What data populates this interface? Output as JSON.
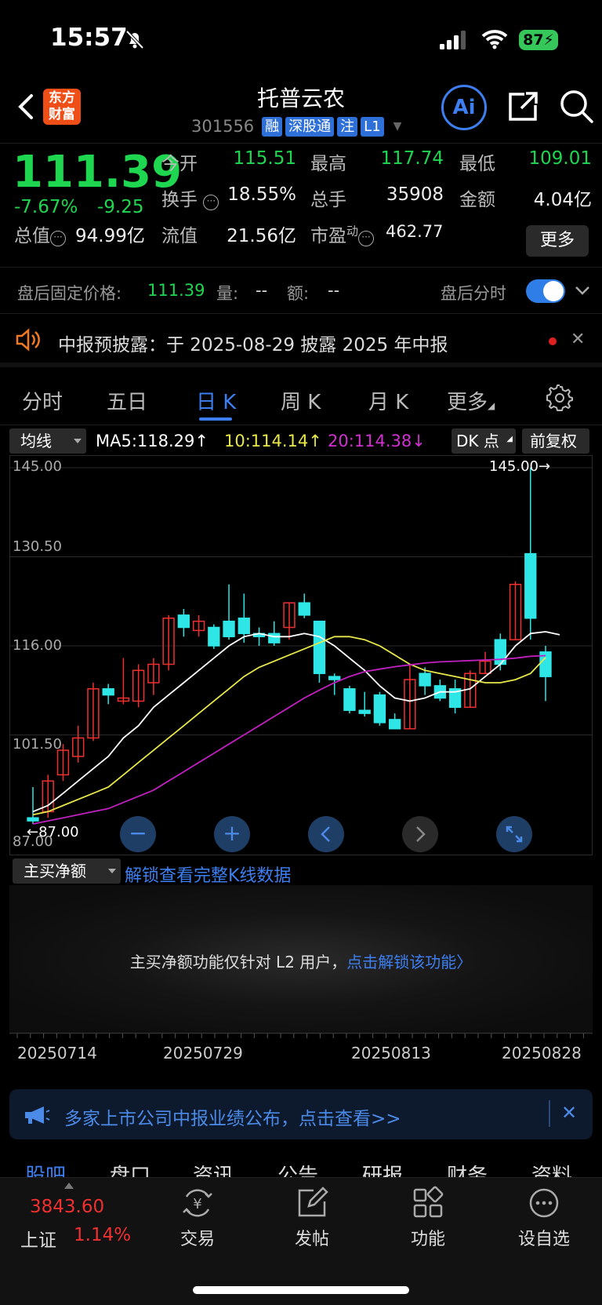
{
  "status_bar": {
    "time": "15:57",
    "battery": "87"
  },
  "header": {
    "logo_text": "东方财富",
    "title": "托普云农",
    "code": "301556",
    "tags": [
      "融",
      "深股通",
      "注",
      "L1"
    ],
    "ai_label": "Ai"
  },
  "quote": {
    "price": "111.39",
    "change_pct": "-7.67%",
    "change": "-9.25",
    "open_label": "今开",
    "open": "115.51",
    "high_label": "最高",
    "high": "117.74",
    "low_label": "最低",
    "low": "109.01",
    "turnover_label": "换手",
    "turnover": "18.55%",
    "volume_label": "总手",
    "volume": "35908",
    "amount_label": "金额",
    "amount": "4.04亿",
    "mcap_label": "总值",
    "mcap": "94.99亿",
    "float_label": "流值",
    "float": "21.56亿",
    "pe_label": "市盈",
    "pe_sup": "动",
    "pe": "462.77",
    "more_button": "更多"
  },
  "after_hours": {
    "price_label": "盘后固定价格:",
    "price": "111.39",
    "vol_label": "量:",
    "vol": "--",
    "amt_label": "额:",
    "amt": "--",
    "toggle_label": "盘后分时"
  },
  "notice": {
    "text": "中报预披露：于 2025-08-29 披露 2025 年中报"
  },
  "tabs": [
    {
      "label": "分时"
    },
    {
      "label": "五日"
    },
    {
      "label": "日 K"
    },
    {
      "label": "周 K"
    },
    {
      "label": "月 K"
    },
    {
      "label": "更多"
    }
  ],
  "ma_bar": {
    "indicator": "均线",
    "ma5": "MA5:118.29↑",
    "ma10": "10:114.14↑",
    "ma20": "20:114.38↓",
    "dk_button": "DK 点",
    "adjust_button": "前复权"
  },
  "chart_data": {
    "type": "candlestick",
    "y_labels": [
      "145.00",
      "130.50",
      "116.00",
      "101.50"
    ],
    "ylim": [
      87.0,
      145.0
    ],
    "max_annotation": "145.00→",
    "min_annotation": "←87.00",
    "min_axis_label": "87.00",
    "candles": [
      {
        "o": 88,
        "h": 93,
        "l": 87,
        "c": 87.5
      },
      {
        "o": 89,
        "h": 95,
        "l": 88,
        "c": 94
      },
      {
        "o": 95,
        "h": 100,
        "l": 94,
        "c": 99
      },
      {
        "o": 98,
        "h": 103,
        "l": 97,
        "c": 101
      },
      {
        "o": 101,
        "h": 110,
        "l": 100.5,
        "c": 109
      },
      {
        "o": 109,
        "h": 109.8,
        "l": 106.5,
        "c": 108
      },
      {
        "o": 107,
        "h": 114,
        "l": 106.5,
        "c": 107.5
      },
      {
        "o": 107,
        "h": 113,
        "l": 106,
        "c": 112
      },
      {
        "o": 110,
        "h": 114,
        "l": 108,
        "c": 113
      },
      {
        "o": 113,
        "h": 121,
        "l": 112,
        "c": 120.5
      },
      {
        "o": 121,
        "h": 122,
        "l": 117.5,
        "c": 119
      },
      {
        "o": 118.5,
        "h": 121,
        "l": 117.5,
        "c": 120
      },
      {
        "o": 119,
        "h": 119.5,
        "l": 115.5,
        "c": 116
      },
      {
        "o": 120,
        "h": 126,
        "l": 117,
        "c": 117.5
      },
      {
        "o": 120.5,
        "h": 124.5,
        "l": 116.5,
        "c": 118
      },
      {
        "o": 118,
        "h": 119,
        "l": 116,
        "c": 117.5
      },
      {
        "o": 118,
        "h": 120,
        "l": 116,
        "c": 116.5
      },
      {
        "o": 119,
        "h": 123,
        "l": 117,
        "c": 123
      },
      {
        "o": 123,
        "h": 124.5,
        "l": 120.5,
        "c": 121
      },
      {
        "o": 120,
        "h": 120,
        "l": 110,
        "c": 111.5
      },
      {
        "o": 111,
        "h": 111.5,
        "l": 108,
        "c": 110.5
      },
      {
        "o": 109,
        "h": 109.5,
        "l": 105,
        "c": 105.5
      },
      {
        "o": 105.5,
        "h": 108.5,
        "l": 104.5,
        "c": 105
      },
      {
        "o": 108,
        "h": 108.5,
        "l": 103,
        "c": 103.5
      },
      {
        "o": 104,
        "h": 105,
        "l": 102.5,
        "c": 102.5
      },
      {
        "o": 102.5,
        "h": 113,
        "l": 102.5,
        "c": 110.5
      },
      {
        "o": 111.5,
        "h": 112.5,
        "l": 108,
        "c": 109.5
      },
      {
        "o": 109.5,
        "h": 110.5,
        "l": 107,
        "c": 107.5
      },
      {
        "o": 109,
        "h": 110.5,
        "l": 105,
        "c": 106
      },
      {
        "o": 106,
        "h": 112,
        "l": 106,
        "c": 111.5
      },
      {
        "o": 111.5,
        "h": 115,
        "l": 111.5,
        "c": 113.5
      },
      {
        "o": 117,
        "h": 118,
        "l": 112,
        "c": 113
      },
      {
        "o": 117,
        "h": 126.5,
        "l": 117,
        "c": 126
      },
      {
        "o": 131,
        "h": 145,
        "l": 117,
        "c": 120.5
      },
      {
        "o": 115,
        "h": 116,
        "l": 107,
        "c": 111
      }
    ],
    "ma_series": [
      {
        "name": "MA5",
        "color": "#ffffff",
        "values": [
          89,
          90,
          92,
          94,
          96,
          98,
          101,
          103,
          106,
          108,
          110,
          112,
          114,
          116,
          117.5,
          118,
          117.5,
          117.5,
          118,
          117.5,
          116,
          114,
          112,
          109.5,
          107.5,
          107,
          107.5,
          108.5,
          108.5,
          109,
          111,
          113,
          116,
          118,
          118.3
        ]
      },
      {
        "name": "MA10",
        "color": "#e8e84a",
        "values": [
          88.5,
          89,
          90,
          91,
          92,
          93,
          95,
          97,
          99,
          101,
          103,
          105,
          107,
          109,
          111,
          112.5,
          113.5,
          114.5,
          115.5,
          116.5,
          117.5,
          117.5,
          117,
          116,
          114.5,
          113,
          112,
          111.5,
          111,
          110.5,
          110,
          110,
          110.5,
          111.5,
          114.1
        ]
      },
      {
        "name": "MA20",
        "color": "#c020c0",
        "values": [
          87,
          87.5,
          88,
          88.5,
          89,
          89.5,
          90.5,
          91.5,
          92.5,
          94,
          95.5,
          97,
          98.5,
          100,
          101.5,
          103,
          104.5,
          106,
          107.5,
          108.8,
          110,
          111,
          111.8,
          112.2,
          112.6,
          112.9,
          113.2,
          113.4,
          113.5,
          113.6,
          113.7,
          113.8,
          114,
          114.3,
          114.4
        ]
      }
    ]
  },
  "chart_controls": [
    "zoom-out",
    "zoom-in",
    "prev",
    "next",
    "fullscreen"
  ],
  "net_flow": {
    "selector": "主买净额",
    "unlock_link": "解锁查看完整K线数据",
    "msg": "主买净额功能仅针对 L2 用户，",
    "msg_link": "点击解锁该功能"
  },
  "x_dates": [
    "20250714",
    "20250729",
    "20250813",
    "20250828"
  ],
  "banner": {
    "text": "多家上市公司中报业绩公布，点击查看>>"
  },
  "subnav": [
    "股吧",
    "盘口",
    "资讯",
    "公告",
    "研报",
    "财务",
    "资料"
  ],
  "bottom_bar": {
    "index_value": "3843.60",
    "index_name": "上证",
    "index_pct": "1.14%",
    "items": [
      {
        "label": "交易",
        "icon": "yuan-exchange-icon"
      },
      {
        "label": "发帖",
        "icon": "edit-icon"
      },
      {
        "label": "功能",
        "icon": "grid-icon"
      },
      {
        "label": "设自选",
        "icon": "more-circle-icon"
      }
    ]
  },
  "colors": {
    "up": "#f03030",
    "down": "#2ee6e6",
    "accent": "#3d7ff0",
    "green": "#1fd651"
  }
}
